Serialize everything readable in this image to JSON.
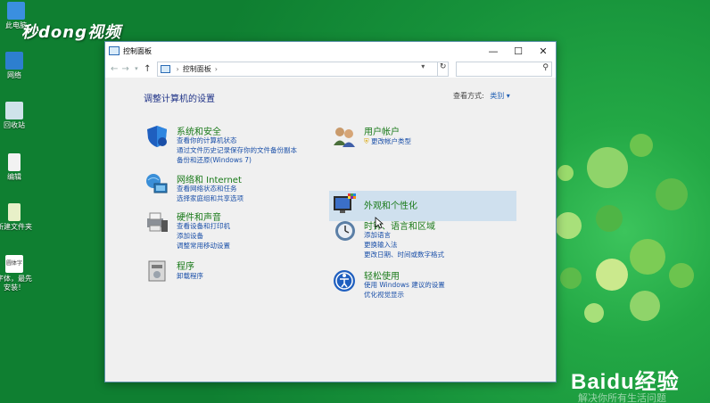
{
  "desktop": {
    "icons": [
      {
        "label": "此电脑"
      },
      {
        "label": "网络"
      },
      {
        "label": "回收站"
      },
      {
        "label": "编辑"
      },
      {
        "label": "新建文件夹"
      },
      {
        "label": "字体，最先安装！",
        "icon_text": "圆体字"
      }
    ],
    "watermark_top": "秒dong视频",
    "watermark_baidu": "Baidu经验",
    "footer_faint": "解决你所有生活问题"
  },
  "window": {
    "title": "控制面板",
    "controls": {
      "minimize": "—",
      "maximize": "☐",
      "close": "✕"
    },
    "address": {
      "path": "控制面板",
      "separator": "›"
    },
    "search_placeholder": "",
    "content": {
      "heading": "调整计算机的设置",
      "view_by_label": "查看方式:",
      "view_by_value": "类别 ▾",
      "categories_left": [
        {
          "title": "系统和安全",
          "icon": "shield-icon",
          "links": [
            "查看你的计算机状态",
            "通过文件历史记录保存你的文件备份副本",
            "备份和还原(Windows 7)"
          ]
        },
        {
          "title": "网络和 Internet",
          "icon": "network-icon",
          "links": [
            "查看网络状态和任务",
            "选择家庭组和共享选项"
          ]
        },
        {
          "title": "硬件和声音",
          "icon": "printer-icon",
          "links": [
            "查看设备和打印机",
            "添加设备",
            "调整常用移动设置"
          ]
        },
        {
          "title": "程序",
          "icon": "programs-icon",
          "links": [
            "卸载程序"
          ]
        }
      ],
      "categories_right": [
        {
          "title": "用户帐户",
          "icon": "users-icon",
          "links": [
            "更改帐户类型"
          ]
        },
        {
          "title": "外观和个性化",
          "icon": "personalization-icon",
          "links": []
        },
        {
          "title": "时钟、语言和区域",
          "icon": "clock-icon",
          "links": [
            "添加语言",
            "更换输入法",
            "更改日期、时间或数字格式"
          ]
        },
        {
          "title": "轻松使用",
          "icon": "accessibility-icon",
          "links": [
            "使用 Windows 建议的设置",
            "优化视觉显示"
          ]
        }
      ]
    }
  },
  "colors": {
    "desktop_green": "#1c9a3f",
    "link_blue": "#1a4fa8",
    "category_green": "#1a7a1a",
    "heading_blue": "#1e3287",
    "hover_bg": "#cfe0ee"
  }
}
